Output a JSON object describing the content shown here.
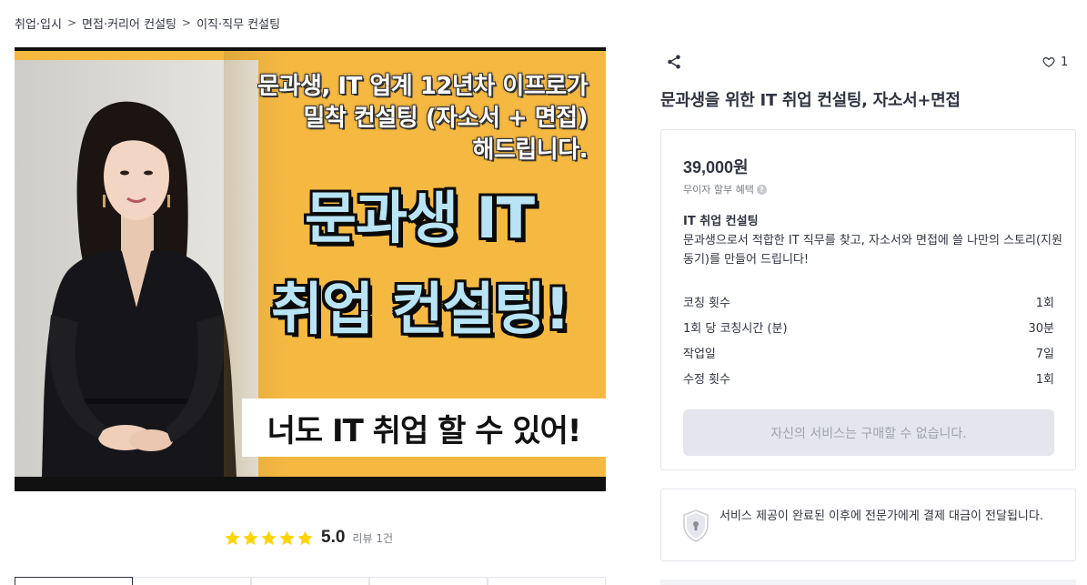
{
  "breadcrumb": {
    "items": [
      "취업·입시",
      "면접·커리어 컨설팅",
      "이직·직무 컨설팅"
    ],
    "separator": ">"
  },
  "hero": {
    "top_text_line1": "문과생, IT 업계 12년차 이프로가",
    "top_text_line2": "밀착 컨설팅 (자소서 + 면접)",
    "top_text_line3": "해드립니다.",
    "big_text_line1": "문과생 IT",
    "big_text_line2": "취업 컨설팅!",
    "banner_text": "너도 IT 취업 할 수 있어!",
    "background_color": "#f5b942",
    "headline_color": "#b8e4f5"
  },
  "rating": {
    "stars": 5,
    "score": "5.0",
    "review_count": "리뷰 1건",
    "star_color": "#ffd400"
  },
  "detail": {
    "like_count": "1",
    "title": "문과생을 위한 IT 취업 컨설팅, 자소서+면접"
  },
  "price_card": {
    "price": "39,000원",
    "installment": "무이자 할부 혜택",
    "package_name": "IT 취업 컨설팅",
    "package_description": "문과생으로서 적합한 IT 직무를 찾고, 자소서와 면접에 쓸 나만의 스토리(지원동기)를 만들어 드립니다!",
    "rows": [
      {
        "label": "코칭 횟수",
        "value": "1회"
      },
      {
        "label": "1회 당 코칭시간 (분)",
        "value": "30분"
      },
      {
        "label": "작업일",
        "value": "7일"
      },
      {
        "label": "수정 횟수",
        "value": "1회"
      }
    ],
    "buy_button": "자신의 서비스는 구매할 수 없습니다."
  },
  "notice": {
    "text": "서비스 제공이 완료된 이후에 전문가에게 결제 대금이 전달됩니다."
  },
  "icons": {
    "share": "share-icon",
    "like": "heart-icon",
    "help": "question-icon",
    "shield": "shield-lock-icon",
    "star": "star-icon"
  }
}
